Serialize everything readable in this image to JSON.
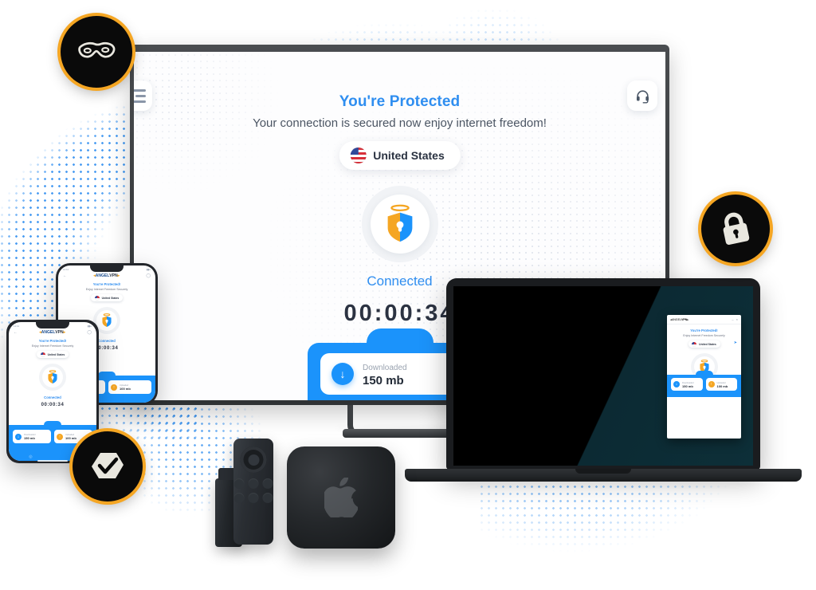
{
  "app": {
    "brand": {
      "part1": "ANGEL",
      "part2": "VPN"
    },
    "monitor_screen": {
      "menu_icon": "hamburger-menu-icon",
      "support_icon": "headset-icon",
      "title": "You're Protected",
      "subtitle": "Your connection is secured now enjoy internet freedom!",
      "country": "United States",
      "shield_icon": "angel-shield-icon",
      "status": "Connected",
      "timer": "00:00:34",
      "stats": [
        {
          "label": "Downloaded",
          "value": "150 mb",
          "icon": "download-arrow-icon",
          "color": "#1b93fb"
        },
        {
          "label": "Uploaded",
          "value": "100 mb",
          "icon": "upload-arrow-icon",
          "color": "#f5a623"
        }
      ]
    },
    "device_screen": {
      "title": "You're Protected!",
      "subtitle": "Enjoy Internet Freedom Securely",
      "country": "United States",
      "status": "Connected",
      "timer": "00:00:34",
      "stats": [
        {
          "label": "Downloaded",
          "value": "150 mb"
        },
        {
          "label": "Uploaded",
          "value": "100 mb"
        }
      ],
      "window_controls": {
        "minimize": "–",
        "close": "×"
      },
      "nav": [
        "globe-icon",
        "shield-icon"
      ],
      "search_icon": "search-icon",
      "back_icon": "back-arrow-icon",
      "statusbar": {
        "time": "11:11",
        "signal": "signal-icon"
      }
    }
  },
  "badges": [
    {
      "name": "anonymity-mask-badge",
      "icon": "mask-icon"
    },
    {
      "name": "security-lock-badge",
      "icon": "padlock-icon"
    },
    {
      "name": "verified-shield-badge",
      "icon": "shield-check-icon"
    }
  ],
  "devices": [
    {
      "name": "desktop-monitor"
    },
    {
      "name": "smartphone-large"
    },
    {
      "name": "smartphone-small"
    },
    {
      "name": "laptop"
    },
    {
      "name": "fire-tv-stick"
    },
    {
      "name": "tv-remote"
    },
    {
      "name": "apple-tv-box"
    }
  ],
  "colors": {
    "accent_blue": "#1b93fb",
    "accent_orange": "#f5a623",
    "text_dark": "#2c3342",
    "text_muted": "#4b5563",
    "badge_ring": "#f5a623",
    "background": "#ffffff"
  }
}
